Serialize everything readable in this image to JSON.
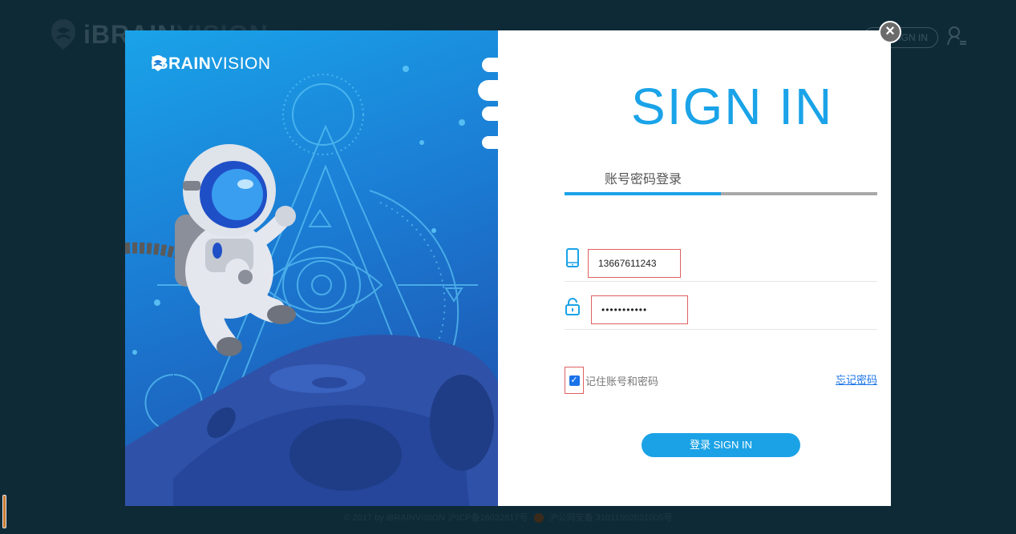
{
  "background": {
    "logo_text_bold": "iBRAIN",
    "logo_text_light": "VISION",
    "header_signin_label": "SIGN IN",
    "footer_text": "© 2017 by iBRAINVISION 沪ICP备16032817号",
    "footer_text2": "沪公网安备 31011502031005号"
  },
  "modal": {
    "brand_bold": "iBRAIN",
    "brand_light": "VISION",
    "close_glyph": "×",
    "title": "SIGN IN",
    "tab_label": "账号密码登录",
    "phone": {
      "value": "13667611243",
      "icon": "phone-icon"
    },
    "password": {
      "value": "•••••••••••",
      "icon": "lock-icon"
    },
    "remember": {
      "checked": true,
      "label": "记住账号和密码"
    },
    "forgot_label": "忘记密码",
    "login_button_label": "登录 SIGN IN"
  },
  "colors": {
    "accent": "#1aa3e8",
    "link": "#1a73e8",
    "overlay": "#0f2a37",
    "highlight_border": "#e06060"
  }
}
